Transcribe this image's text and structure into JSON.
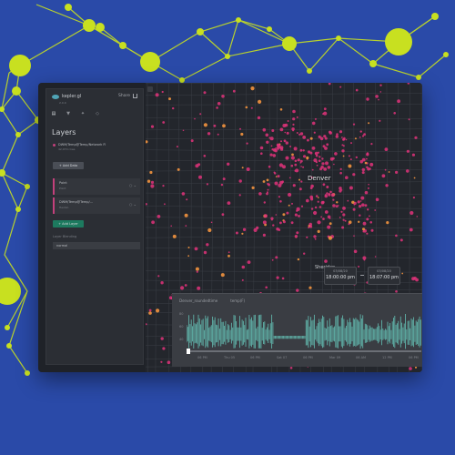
{
  "colors": {
    "background": "#2a4aa8",
    "accent_network": "#c8e020",
    "point": "#e0337a",
    "point_hot": "#ff9a40",
    "timeline_wave": "#5fb1a8"
  },
  "sidebar": {
    "brand_name": "kepler.gl",
    "brand_version": "2.0.0",
    "share_label": "Share",
    "tabs": [
      {
        "icon": "layers-icon"
      },
      {
        "icon": "filter-icon"
      },
      {
        "icon": "interaction-icon"
      },
      {
        "icon": "basemap-icon"
      }
    ],
    "title": "Layers",
    "dataset": {
      "name": "DWM/Temp@Temp/Network Fl",
      "rows": "42,070 rows"
    },
    "add_data_label": "+ Add Data",
    "layers": [
      {
        "name": "Point",
        "type": "Point"
      },
      {
        "name": "DWM/Temp@Temp/...",
        "type": "Hexbin"
      }
    ],
    "add_layer_label": "+ Add Layer",
    "blend_label": "Layer Blending",
    "blend_value": "normal"
  },
  "map": {
    "city_main": "Denver",
    "city_south": "Sheridan",
    "time_start": {
      "date": "03/08/20",
      "time": "18:00:00 pm"
    },
    "time_end": {
      "date": "03/08/20",
      "time": "18:07:00 pm"
    }
  },
  "timeline": {
    "series_a": "Denver_roundedtime",
    "series_b": "temp(F)",
    "y_labels": [
      "80",
      "60",
      "40"
    ],
    "x_ticks": [
      "06 PM",
      "Thu 05",
      "06 PM",
      "Sat 07",
      "06 PM",
      "Mar 09",
      "06 AM",
      "12 PM",
      "06 PM"
    ]
  }
}
